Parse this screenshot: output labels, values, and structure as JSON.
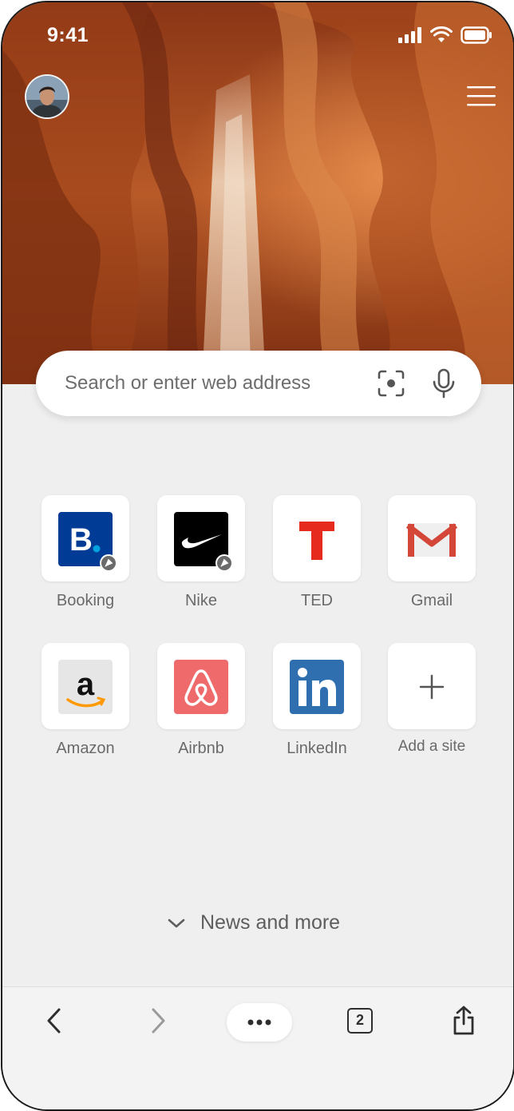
{
  "status_bar": {
    "time": "9:41",
    "icons": [
      "cellular-signal-icon",
      "wifi-icon",
      "battery-icon"
    ]
  },
  "header": {
    "avatar": "profile-avatar",
    "menu_icon": "hamburger-menu-icon"
  },
  "search": {
    "placeholder": "Search or enter web address",
    "icons": [
      "visual-search-icon",
      "microphone-icon"
    ]
  },
  "top_sites": [
    {
      "label": "Booking",
      "icon": "booking-logo",
      "pinned": true,
      "brand_color": "#003b95"
    },
    {
      "label": "Nike",
      "icon": "nike-logo",
      "pinned": true,
      "brand_color": "#000000"
    },
    {
      "label": "TED",
      "icon": "ted-logo",
      "pinned": false,
      "brand_color": "#e62b1e"
    },
    {
      "label": "Gmail",
      "icon": "gmail-logo",
      "pinned": false,
      "brand_color": "#d44638"
    },
    {
      "label": "Amazon",
      "icon": "amazon-logo",
      "pinned": false,
      "brand_color": "#ff9900"
    },
    {
      "label": "Airbnb",
      "icon": "airbnb-logo",
      "pinned": false,
      "brand_color": "#ef6a6a"
    },
    {
      "label": "LinkedIn",
      "icon": "linkedin-logo",
      "pinned": false,
      "brand_color": "#2f6fb0"
    },
    {
      "label": "Add a site",
      "icon": "plus-icon",
      "pinned": false
    }
  ],
  "news": {
    "label": "News and more",
    "icon": "chevron-down-icon"
  },
  "toolbar": {
    "back_icon": "back-arrow-icon",
    "forward_icon": "forward-arrow-icon",
    "more_icon": "more-options-icon",
    "tab_count": "2",
    "share_icon": "share-icon"
  }
}
